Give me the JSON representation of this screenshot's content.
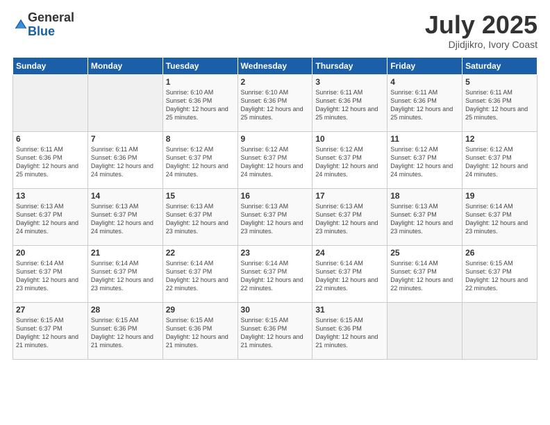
{
  "header": {
    "logo_general": "General",
    "logo_blue": "Blue",
    "month_title": "July 2025",
    "subtitle": "Djidjikro, Ivory Coast"
  },
  "weekdays": [
    "Sunday",
    "Monday",
    "Tuesday",
    "Wednesday",
    "Thursday",
    "Friday",
    "Saturday"
  ],
  "weeks": [
    [
      {
        "day": "",
        "sunrise": "",
        "sunset": "",
        "daylight": ""
      },
      {
        "day": "",
        "sunrise": "",
        "sunset": "",
        "daylight": ""
      },
      {
        "day": "1",
        "sunrise": "Sunrise: 6:10 AM",
        "sunset": "Sunset: 6:36 PM",
        "daylight": "Daylight: 12 hours and 25 minutes."
      },
      {
        "day": "2",
        "sunrise": "Sunrise: 6:10 AM",
        "sunset": "Sunset: 6:36 PM",
        "daylight": "Daylight: 12 hours and 25 minutes."
      },
      {
        "day": "3",
        "sunrise": "Sunrise: 6:11 AM",
        "sunset": "Sunset: 6:36 PM",
        "daylight": "Daylight: 12 hours and 25 minutes."
      },
      {
        "day": "4",
        "sunrise": "Sunrise: 6:11 AM",
        "sunset": "Sunset: 6:36 PM",
        "daylight": "Daylight: 12 hours and 25 minutes."
      },
      {
        "day": "5",
        "sunrise": "Sunrise: 6:11 AM",
        "sunset": "Sunset: 6:36 PM",
        "daylight": "Daylight: 12 hours and 25 minutes."
      }
    ],
    [
      {
        "day": "6",
        "sunrise": "Sunrise: 6:11 AM",
        "sunset": "Sunset: 6:36 PM",
        "daylight": "Daylight: 12 hours and 25 minutes."
      },
      {
        "day": "7",
        "sunrise": "Sunrise: 6:11 AM",
        "sunset": "Sunset: 6:36 PM",
        "daylight": "Daylight: 12 hours and 24 minutes."
      },
      {
        "day": "8",
        "sunrise": "Sunrise: 6:12 AM",
        "sunset": "Sunset: 6:37 PM",
        "daylight": "Daylight: 12 hours and 24 minutes."
      },
      {
        "day": "9",
        "sunrise": "Sunrise: 6:12 AM",
        "sunset": "Sunset: 6:37 PM",
        "daylight": "Daylight: 12 hours and 24 minutes."
      },
      {
        "day": "10",
        "sunrise": "Sunrise: 6:12 AM",
        "sunset": "Sunset: 6:37 PM",
        "daylight": "Daylight: 12 hours and 24 minutes."
      },
      {
        "day": "11",
        "sunrise": "Sunrise: 6:12 AM",
        "sunset": "Sunset: 6:37 PM",
        "daylight": "Daylight: 12 hours and 24 minutes."
      },
      {
        "day": "12",
        "sunrise": "Sunrise: 6:12 AM",
        "sunset": "Sunset: 6:37 PM",
        "daylight": "Daylight: 12 hours and 24 minutes."
      }
    ],
    [
      {
        "day": "13",
        "sunrise": "Sunrise: 6:13 AM",
        "sunset": "Sunset: 6:37 PM",
        "daylight": "Daylight: 12 hours and 24 minutes."
      },
      {
        "day": "14",
        "sunrise": "Sunrise: 6:13 AM",
        "sunset": "Sunset: 6:37 PM",
        "daylight": "Daylight: 12 hours and 24 minutes."
      },
      {
        "day": "15",
        "sunrise": "Sunrise: 6:13 AM",
        "sunset": "Sunset: 6:37 PM",
        "daylight": "Daylight: 12 hours and 23 minutes."
      },
      {
        "day": "16",
        "sunrise": "Sunrise: 6:13 AM",
        "sunset": "Sunset: 6:37 PM",
        "daylight": "Daylight: 12 hours and 23 minutes."
      },
      {
        "day": "17",
        "sunrise": "Sunrise: 6:13 AM",
        "sunset": "Sunset: 6:37 PM",
        "daylight": "Daylight: 12 hours and 23 minutes."
      },
      {
        "day": "18",
        "sunrise": "Sunrise: 6:13 AM",
        "sunset": "Sunset: 6:37 PM",
        "daylight": "Daylight: 12 hours and 23 minutes."
      },
      {
        "day": "19",
        "sunrise": "Sunrise: 6:14 AM",
        "sunset": "Sunset: 6:37 PM",
        "daylight": "Daylight: 12 hours and 23 minutes."
      }
    ],
    [
      {
        "day": "20",
        "sunrise": "Sunrise: 6:14 AM",
        "sunset": "Sunset: 6:37 PM",
        "daylight": "Daylight: 12 hours and 23 minutes."
      },
      {
        "day": "21",
        "sunrise": "Sunrise: 6:14 AM",
        "sunset": "Sunset: 6:37 PM",
        "daylight": "Daylight: 12 hours and 23 minutes."
      },
      {
        "day": "22",
        "sunrise": "Sunrise: 6:14 AM",
        "sunset": "Sunset: 6:37 PM",
        "daylight": "Daylight: 12 hours and 22 minutes."
      },
      {
        "day": "23",
        "sunrise": "Sunrise: 6:14 AM",
        "sunset": "Sunset: 6:37 PM",
        "daylight": "Daylight: 12 hours and 22 minutes."
      },
      {
        "day": "24",
        "sunrise": "Sunrise: 6:14 AM",
        "sunset": "Sunset: 6:37 PM",
        "daylight": "Daylight: 12 hours and 22 minutes."
      },
      {
        "day": "25",
        "sunrise": "Sunrise: 6:14 AM",
        "sunset": "Sunset: 6:37 PM",
        "daylight": "Daylight: 12 hours and 22 minutes."
      },
      {
        "day": "26",
        "sunrise": "Sunrise: 6:15 AM",
        "sunset": "Sunset: 6:37 PM",
        "daylight": "Daylight: 12 hours and 22 minutes."
      }
    ],
    [
      {
        "day": "27",
        "sunrise": "Sunrise: 6:15 AM",
        "sunset": "Sunset: 6:37 PM",
        "daylight": "Daylight: 12 hours and 21 minutes."
      },
      {
        "day": "28",
        "sunrise": "Sunrise: 6:15 AM",
        "sunset": "Sunset: 6:36 PM",
        "daylight": "Daylight: 12 hours and 21 minutes."
      },
      {
        "day": "29",
        "sunrise": "Sunrise: 6:15 AM",
        "sunset": "Sunset: 6:36 PM",
        "daylight": "Daylight: 12 hours and 21 minutes."
      },
      {
        "day": "30",
        "sunrise": "Sunrise: 6:15 AM",
        "sunset": "Sunset: 6:36 PM",
        "daylight": "Daylight: 12 hours and 21 minutes."
      },
      {
        "day": "31",
        "sunrise": "Sunrise: 6:15 AM",
        "sunset": "Sunset: 6:36 PM",
        "daylight": "Daylight: 12 hours and 21 minutes."
      },
      {
        "day": "",
        "sunrise": "",
        "sunset": "",
        "daylight": ""
      },
      {
        "day": "",
        "sunrise": "",
        "sunset": "",
        "daylight": ""
      }
    ]
  ]
}
